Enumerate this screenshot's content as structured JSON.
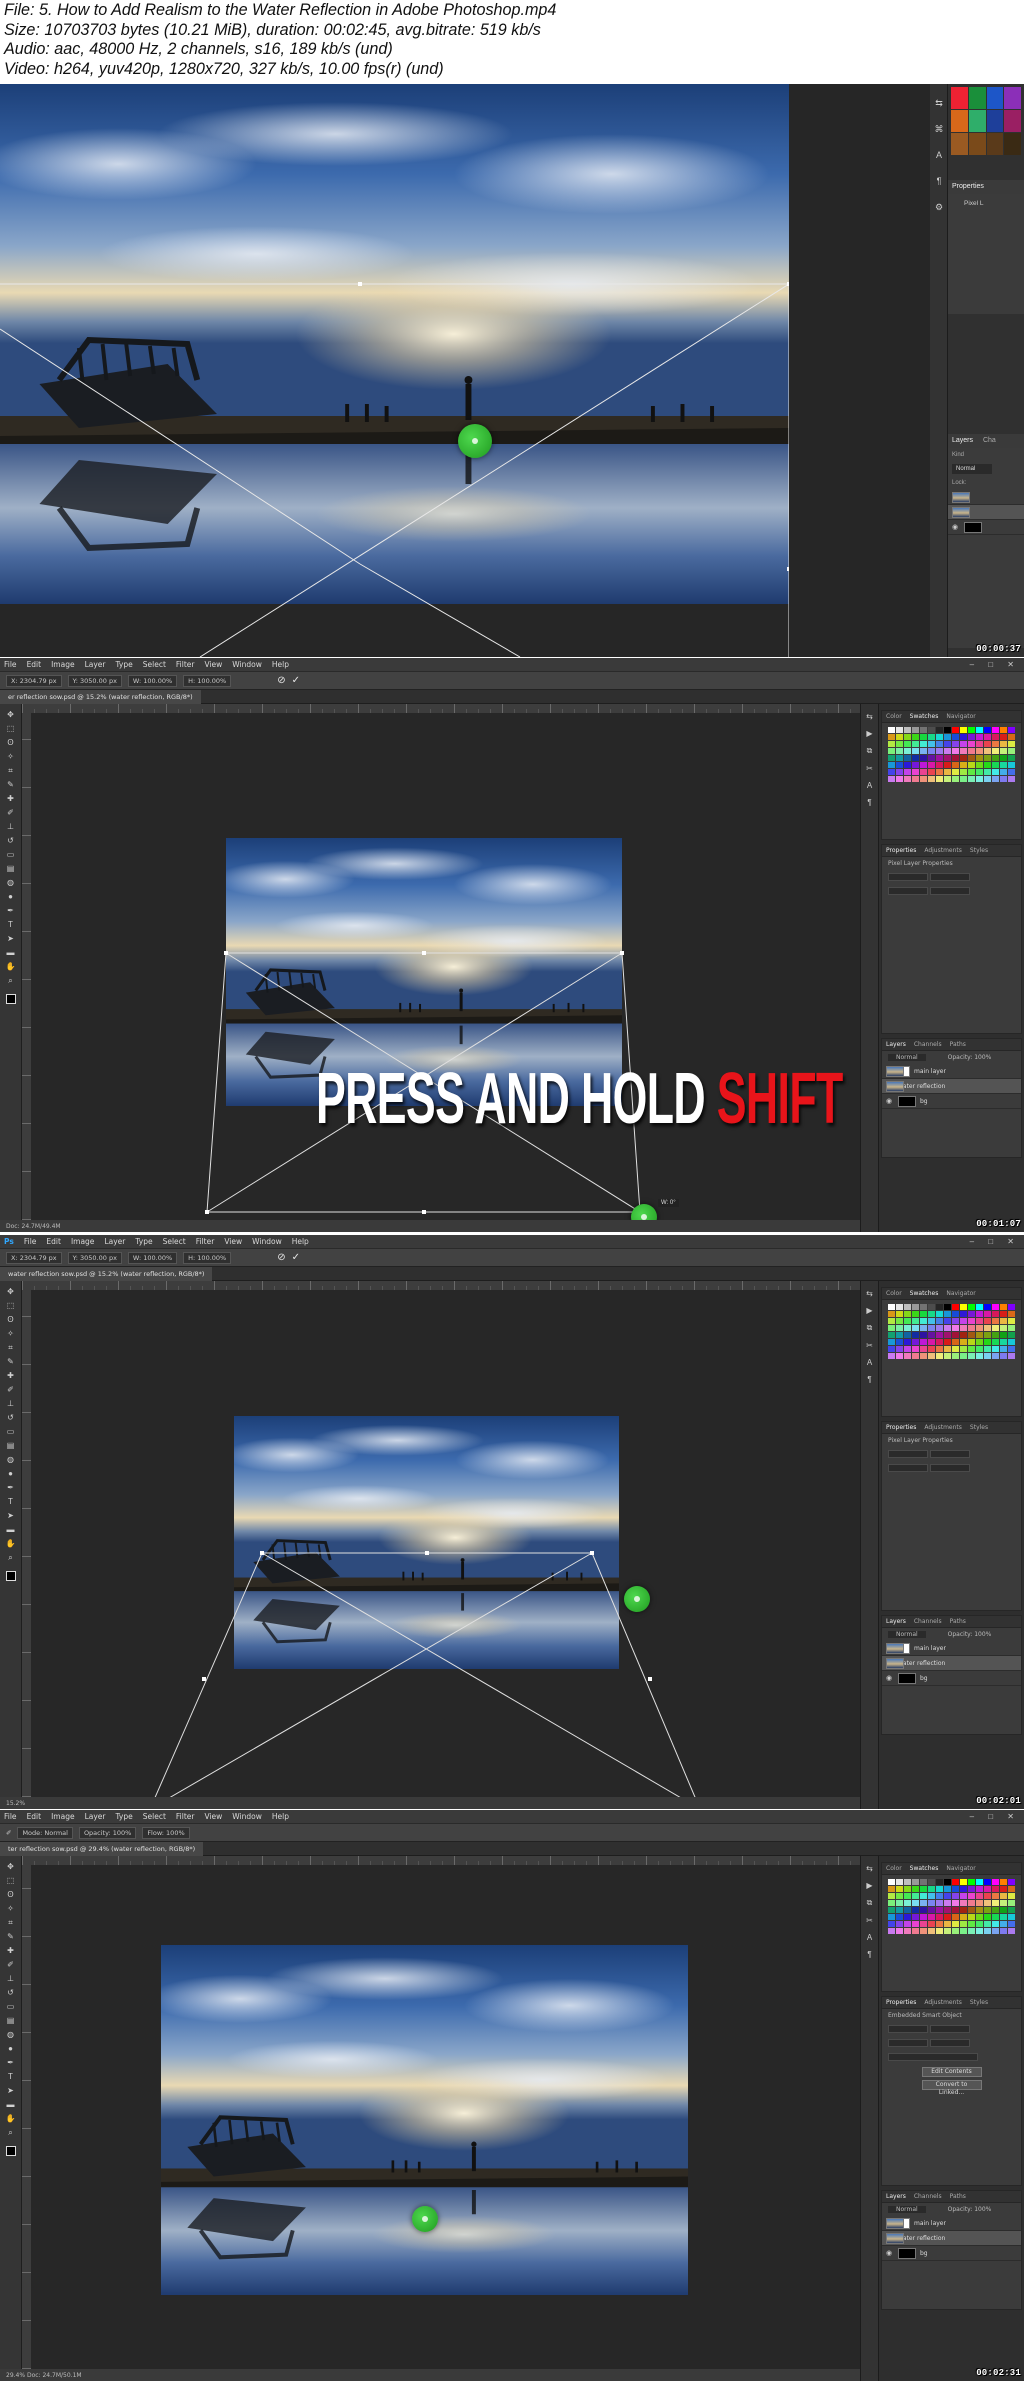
{
  "header": {
    "line1": "File: 5. How to Add Realism to the Water Reflection in Adobe Photoshop.mp4",
    "line2": "Size: 10703703 bytes (10.21 MiB), duration: 00:02:45, avg.bitrate: 519 kb/s",
    "line3": "Audio: aac, 48000 Hz, 2 channels, s16, 189 kb/s (und)",
    "line4": "Video: h264, yuv420p, 1280x720, 327 kb/s, 10.00 fps(r) (und)"
  },
  "frames": [
    {
      "timestamp": "00:00:37",
      "properties_label": "Properties",
      "properties_sub": "Pixel L",
      "layers_label": "Layers",
      "layers_tab2": "Cha",
      "kind": "Kind",
      "blend": "Normal",
      "lock": "Lock:"
    },
    {
      "timestamp": "00:01:07",
      "overlay_white": "PRESS AND HOLD ",
      "overlay_red": "SHIFT"
    },
    {
      "timestamp": "00:02:01"
    },
    {
      "timestamp": "00:02:31"
    }
  ],
  "menu": [
    "File",
    "Edit",
    "Image",
    "Layer",
    "Type",
    "Select",
    "Filter",
    "View",
    "Window",
    "Help"
  ],
  "ps_logo": "Ps",
  "doc_tab": "er reflection sow.psd @ 15.2% (water reflection, RGB/8*)",
  "doc_tab3": "water reflection sow.psd @ 15.2% (water reflection, RGB/8*)",
  "doc_tab4": "ter reflection sow.psd @ 29.4% (water reflection, RGB/8*)",
  "panels": {
    "color_tabs": [
      "Color",
      "Swatches",
      "Navigator"
    ],
    "prop_tabs": [
      "Properties",
      "Adjustments",
      "Styles"
    ],
    "pixel_layer_props": "Pixel Layer Properties",
    "embedded_props": "Embedded Smart Object",
    "edit_contents": "Edit Contents",
    "convert_linked": "Convert to Linked...",
    "layer_tabs": [
      "Layers",
      "Channels",
      "Paths"
    ],
    "blend": "Normal",
    "opacity": "Opacity: 100%",
    "layers": [
      "main layer",
      "water reflection",
      "bg"
    ]
  },
  "optbar": {
    "x": "X: 2304.79 px",
    "y": "Y: 3050.00 px",
    "w": "W: 100.00%",
    "h": "H: 100.00%",
    "mode": "Mode: Normal",
    "opacity": "Opacity: 100%",
    "flow": "Flow: 100%"
  },
  "status": {
    "f2": "Doc: 24.7M/49.4M",
    "f3": "15.2%",
    "f4": "29.4%  Doc: 24.7M/50.1M"
  },
  "transform_readout": "W: 0°"
}
